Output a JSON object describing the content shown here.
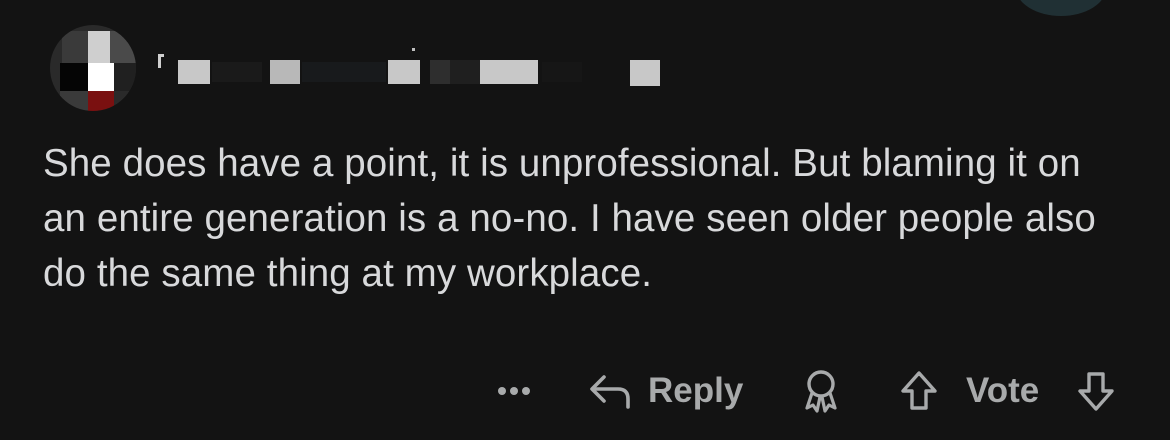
{
  "comment": {
    "body": "She does have a point, it is unprofessional. But blaming it on an entire generation is a no-no. I have seen older people also do the same thing at my workplace."
  },
  "actions": {
    "more_icon": "more-dots-icon",
    "reply_icon": "reply-arrow-icon",
    "reply_label": "Reply",
    "award_icon": "award-ribbon-icon",
    "upvote_icon": "upvote-arrow-icon",
    "vote_label": "Vote",
    "downvote_icon": "downvote-arrow-icon"
  },
  "colors": {
    "background": "#131313",
    "text": "#d8d9db",
    "action_text": "#a8aaab"
  }
}
